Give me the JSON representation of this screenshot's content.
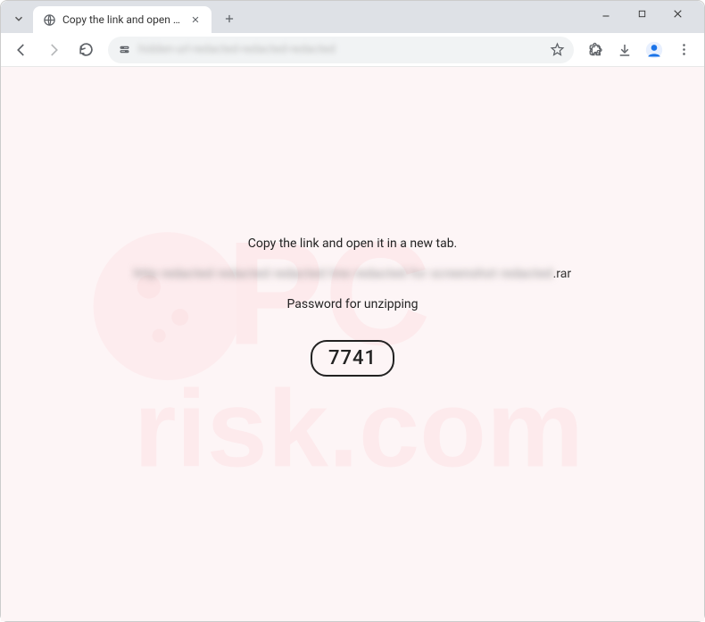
{
  "window": {
    "tab_title": "Copy the link and open it in a n"
  },
  "toolbar": {
    "url_placeholder": "hidden-url-redacted-redacted-redacted"
  },
  "page": {
    "instruction": "Copy the link and open it in a new tab.",
    "blurred_url": "http redacted redacted redacted line redacted for screenshot redacted",
    "url_suffix": ".rar",
    "password_label": "Password for unzipping",
    "password_value": "7741"
  },
  "watermark": {
    "top": "PC",
    "bottom": "risk.com"
  }
}
